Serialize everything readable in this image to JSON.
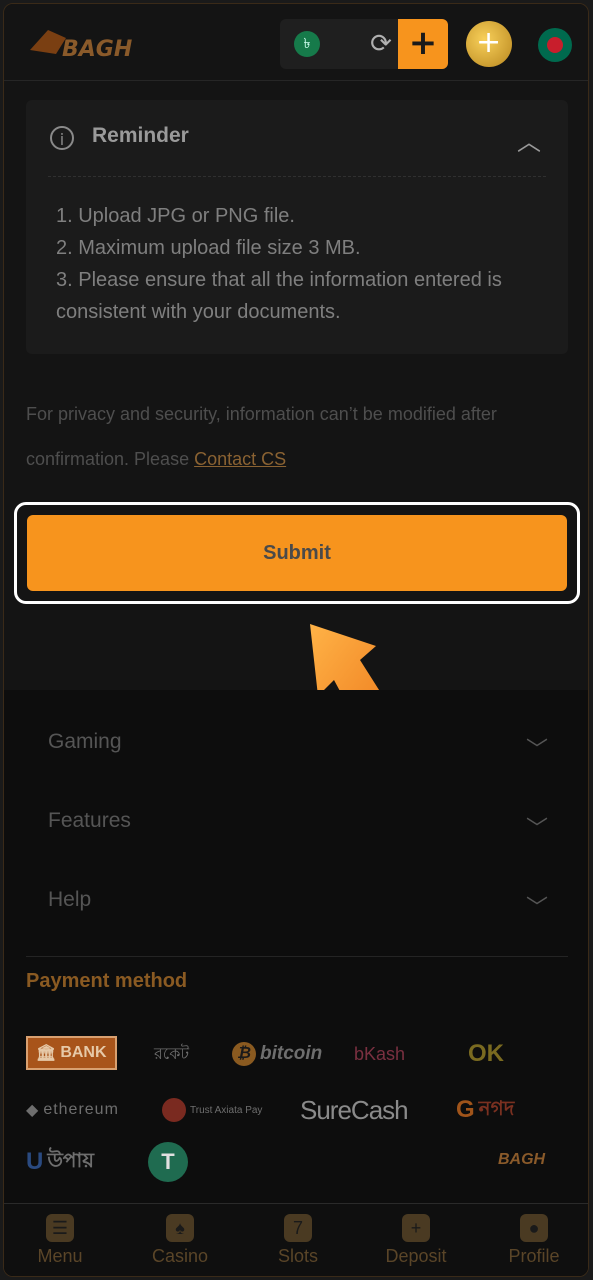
{
  "header": {
    "brand": "BAGH",
    "currency_symbol": "৳",
    "balance": "",
    "refresh_icon": "refresh-icon",
    "add_icon": "plus-icon"
  },
  "reminder": {
    "title": "Reminder",
    "lines": [
      "1. Upload JPG or PNG file.",
      "2. Maximum upload file size 3 MB.",
      "3. Please ensure that all the information entered is consistent with your documents."
    ]
  },
  "privacy": {
    "text": "For privacy and security, information can’t be modified after confirmation. Please ",
    "link": "Contact CS"
  },
  "submit_label": "Submit",
  "footer": {
    "sections": [
      "Gaming",
      "Features",
      "Help"
    ],
    "payment_title": "Payment method",
    "payments": [
      "BANK",
      "রকেট",
      "bitcoin",
      "bKash",
      "OK",
      "ethereum",
      "Trust Axiata Pay",
      "SureCash",
      "নগদ",
      "উপায়",
      "T"
    ],
    "brand_mark": "BAGH"
  },
  "nav": [
    "Menu",
    "Casino",
    "Slots",
    "Deposit",
    "Profile"
  ],
  "colors": {
    "accent": "#f7941d",
    "background": "#141414"
  }
}
